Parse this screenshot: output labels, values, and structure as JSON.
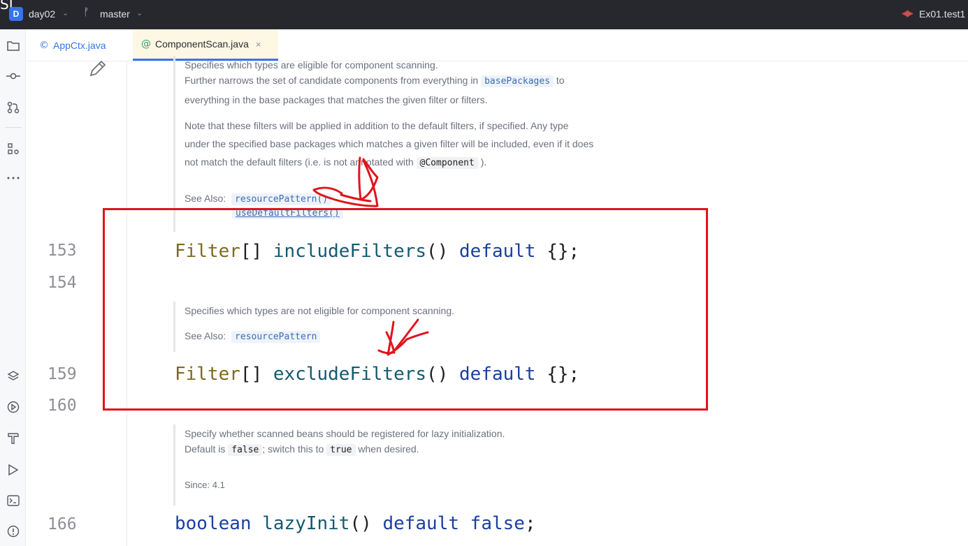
{
  "topbar": {
    "corner_glyph": "SI",
    "project_badge": "D",
    "project_name": "day02",
    "project_chevron": "⌄",
    "branch_icon": "ᚠ",
    "branch_name": "master",
    "branch_chevron": "⌄",
    "run_config_icon": "◀▶",
    "run_config": "Ex01.test1"
  },
  "toolstrip": {
    "icons": [
      "folder-icon",
      "commit-icon",
      "pull-requests-icon",
      "structure-icon",
      "more-icon",
      "layers-icon",
      "services-icon",
      "build-icon",
      "run-icon",
      "terminal-icon",
      "problems-icon"
    ]
  },
  "tabs": [
    {
      "icon": "©",
      "label": "AppCtx.java",
      "active": false
    },
    {
      "icon": "@",
      "label": "ComponentScan.java",
      "active": true,
      "close": "×"
    }
  ],
  "editor": {
    "doc1": {
      "line1": "Specifies which types are eligible for component scanning.",
      "line2a": "Further narrows the set of candidate components from everything in",
      "line2_chip": "basePackages",
      "line2b": "to",
      "line3": "everything in the base packages that matches the given filter or filters.",
      "line4": "Note that these filters will be applied in addition to the default filters, if specified. Any type",
      "line5": "under the specified base packages which matches a given filter will be included, even if it does",
      "line6a": "not match the default filters (i.e. is not annotated with",
      "line6_chip": "@Component",
      "line6b": ").",
      "see_also_label": "See Also:",
      "see_also_1": "resourcePattern()",
      "see_also_2": "useDefaultFilters()"
    },
    "line_153": {
      "number": "153",
      "type": "Filter",
      "brackets": "[]",
      "method": "includeFilters",
      "parens": "()",
      "keyword": "default",
      "tail": "{};"
    },
    "line_154": {
      "number": "154"
    },
    "doc2": {
      "line1": "Specifies which types are not eligible for component scanning.",
      "see_also_label": "See Also:",
      "see_also_1": "resourcePattern"
    },
    "line_159": {
      "number": "159",
      "type": "Filter",
      "brackets": "[]",
      "method": "excludeFilters",
      "parens": "()",
      "keyword": "default",
      "tail": "{};"
    },
    "line_160": {
      "number": "160"
    },
    "doc3": {
      "line1": "Specify whether scanned beans should be registered for lazy initialization.",
      "line2a": "Default is",
      "line2_chip1": "false",
      "line2b": "; switch this to",
      "line2_chip2": "true",
      "line2c": "when desired.",
      "since": "Since: 4.1"
    },
    "line_166": {
      "number": "166",
      "type": "boolean",
      "method": "lazyInit",
      "parens": "()",
      "keyword1": "default",
      "keyword2": "false",
      "tail": ";"
    }
  },
  "colors": {
    "annotation_red": "#e0141b",
    "accent_blue": "#3574f0",
    "topbar_bg": "#27282e"
  }
}
